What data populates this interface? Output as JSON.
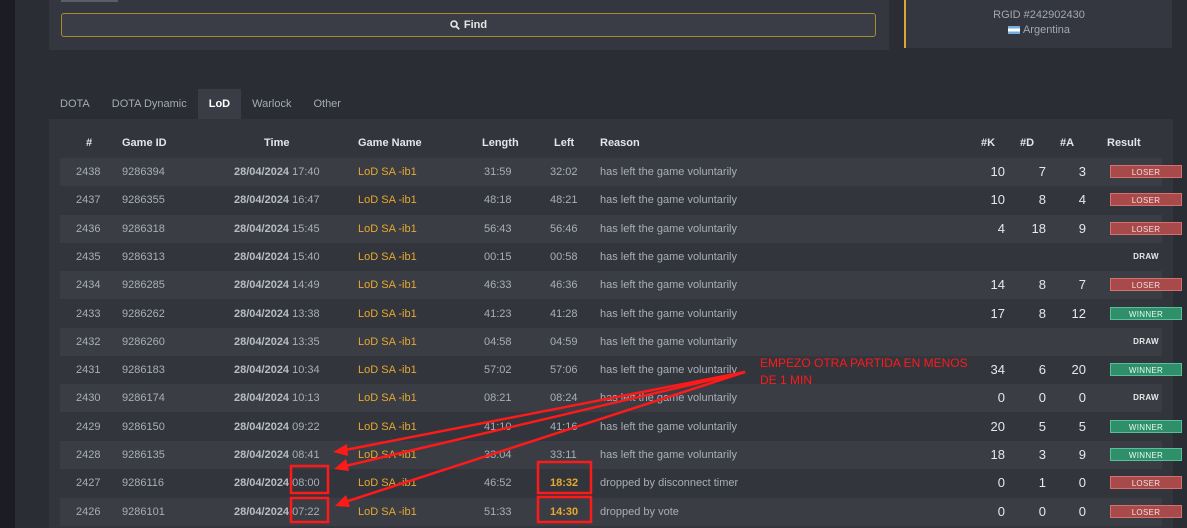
{
  "search": {
    "find_label": "Find"
  },
  "profile": {
    "rgid": "RGID #242902430",
    "country": "Argentina"
  },
  "tabs": [
    {
      "label": "DOTA",
      "active": false
    },
    {
      "label": "DOTA Dynamic",
      "active": false
    },
    {
      "label": "LoD",
      "active": true
    },
    {
      "label": "Warlock",
      "active": false
    },
    {
      "label": "Other",
      "active": false
    }
  ],
  "table": {
    "headers": {
      "idx": "#",
      "game_id": "Game ID",
      "time": "Time",
      "game_name": "Game Name",
      "length": "Length",
      "left": "Left",
      "reason": "Reason",
      "k": "#K",
      "d": "#D",
      "a": "#A",
      "result": "Result"
    },
    "rows": [
      {
        "idx": "2438",
        "game_id": "9286394",
        "date": "28/04/2024",
        "clock": "17:40",
        "game_name": "LoD SA -ib1",
        "length": "31:59",
        "left": "32:02",
        "reason": "has left the game voluntarily",
        "k": "10",
        "d": "7",
        "a": "3",
        "result": "LOSER"
      },
      {
        "idx": "2437",
        "game_id": "9286355",
        "date": "28/04/2024",
        "clock": "16:47",
        "game_name": "LoD SA -ib1",
        "length": "48:18",
        "left": "48:21",
        "reason": "has left the game voluntarily",
        "k": "10",
        "d": "8",
        "a": "4",
        "result": "LOSER"
      },
      {
        "idx": "2436",
        "game_id": "9286318",
        "date": "28/04/2024",
        "clock": "15:45",
        "game_name": "LoD SA -ib1",
        "length": "56:43",
        "left": "56:46",
        "reason": "has left the game voluntarily",
        "k": "4",
        "d": "18",
        "a": "9",
        "result": "LOSER"
      },
      {
        "idx": "2435",
        "game_id": "9286313",
        "date": "28/04/2024",
        "clock": "15:40",
        "game_name": "LoD SA -ib1",
        "length": "00:15",
        "left": "00:58",
        "reason": "has left the game voluntarily",
        "k": "",
        "d": "",
        "a": "",
        "result": "DRAW"
      },
      {
        "idx": "2434",
        "game_id": "9286285",
        "date": "28/04/2024",
        "clock": "14:49",
        "game_name": "LoD SA -ib1",
        "length": "46:33",
        "left": "46:36",
        "reason": "has left the game voluntarily",
        "k": "14",
        "d": "8",
        "a": "7",
        "result": "LOSER"
      },
      {
        "idx": "2433",
        "game_id": "9286262",
        "date": "28/04/2024",
        "clock": "13:38",
        "game_name": "LoD SA -ib1",
        "length": "41:23",
        "left": "41:28",
        "reason": "has left the game voluntarily",
        "k": "17",
        "d": "8",
        "a": "12",
        "result": "WINNER"
      },
      {
        "idx": "2432",
        "game_id": "9286260",
        "date": "28/04/2024",
        "clock": "13:35",
        "game_name": "LoD SA -ib1",
        "length": "04:58",
        "left": "04:59",
        "reason": "has left the game voluntarily",
        "k": "",
        "d": "",
        "a": "",
        "result": "DRAW"
      },
      {
        "idx": "2431",
        "game_id": "9286183",
        "date": "28/04/2024",
        "clock": "10:34",
        "game_name": "LoD SA -ib1",
        "length": "57:02",
        "left": "57:06",
        "reason": "has left the game voluntarily",
        "k": "34",
        "d": "6",
        "a": "20",
        "result": "WINNER"
      },
      {
        "idx": "2430",
        "game_id": "9286174",
        "date": "28/04/2024",
        "clock": "10:13",
        "game_name": "LoD SA -ib1",
        "length": "08:21",
        "left": "08:24",
        "reason": "has left the game voluntarily",
        "k": "0",
        "d": "0",
        "a": "0",
        "result": "DRAW"
      },
      {
        "idx": "2429",
        "game_id": "9286150",
        "date": "28/04/2024",
        "clock": "09:22",
        "game_name": "LoD SA -ib1",
        "length": "41:10",
        "left": "41:16",
        "reason": "has left the game voluntarily",
        "k": "20",
        "d": "5",
        "a": "5",
        "result": "WINNER"
      },
      {
        "idx": "2428",
        "game_id": "9286135",
        "date": "28/04/2024",
        "clock": "08:41",
        "game_name": "LoD SA -ib1",
        "length": "33:04",
        "left": "33:11",
        "reason": "has left the game voluntarily",
        "k": "18",
        "d": "3",
        "a": "9",
        "result": "WINNER"
      },
      {
        "idx": "2427",
        "game_id": "9286116",
        "date": "28/04/2024",
        "clock": "08:00",
        "game_name": "LoD SA -ib1",
        "length": "46:52",
        "left": "18:32",
        "reason": "dropped by disconnect timer",
        "k": "0",
        "d": "1",
        "a": "0",
        "result": "LOSER"
      },
      {
        "idx": "2426",
        "game_id": "9286101",
        "date": "28/04/2024",
        "clock": "07:22",
        "game_name": "LoD SA -ib1",
        "length": "51:33",
        "left": "14:30",
        "reason": "dropped by vote",
        "k": "0",
        "d": "0",
        "a": "0",
        "result": "LOSER"
      }
    ]
  },
  "annotation": {
    "line1": "EMPEZO OTRA PARTIDA EN MENOS",
    "line2": "DE 1 MIN",
    "color": "#ff1a1a"
  }
}
